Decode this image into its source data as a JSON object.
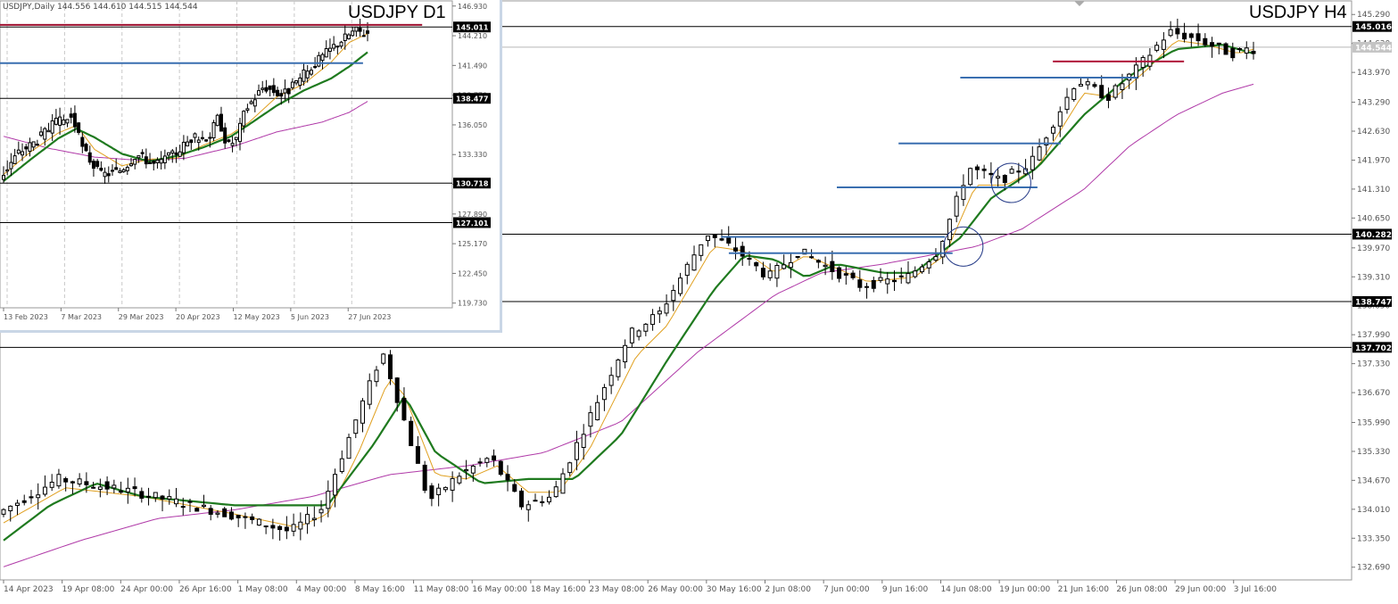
{
  "main": {
    "title": "USDJPY H4",
    "y_ticks": [
      "145.290",
      "144.630",
      "143.970",
      "143.290",
      "142.630",
      "141.970",
      "141.310",
      "140.650",
      "139.970",
      "139.310",
      "138.650",
      "137.990",
      "137.330",
      "136.670",
      "135.990",
      "135.330",
      "134.670",
      "134.010",
      "133.350",
      "132.690"
    ],
    "x_ticks": [
      "14 Apr 2023",
      "19 Apr 08:00",
      "24 Apr 00:00",
      "26 Apr 16:00",
      "1 May 08:00",
      "4 May 00:00",
      "8 May 16:00",
      "11 May 08:00",
      "16 May 00:00",
      "18 May 16:00",
      "23 May 08:00",
      "26 May 00:00",
      "30 May 16:00",
      "2 Jun 08:00",
      "7 Jun 00:00",
      "9 Jun 16:00",
      "14 Jun 08:00",
      "19 Jun 00:00",
      "21 Jun 16:00",
      "26 Jun 08:00",
      "29 Jun 00:00",
      "3 Jul 16:00"
    ],
    "price_labels": [
      "145.016",
      "144.544",
      "140.282",
      "138.747",
      "137.702"
    ]
  },
  "inset": {
    "title": "USDJPY D1",
    "info": "USDJPY,Daily  144.556 144.610 144.515 144.544",
    "y_ticks": [
      "146.930",
      "144.210",
      "141.490",
      "138.770",
      "136.050",
      "133.330",
      "130.610",
      "127.890",
      "125.170",
      "122.450",
      "119.730"
    ],
    "x_ticks": [
      "13 Feb 2023",
      "7 Mar 2023",
      "29 Mar 2023",
      "20 Apr 2023",
      "12 May 2023",
      "5 Jun 2023",
      "27 Jun 2023"
    ],
    "price_labels": [
      "145.011",
      "138.477",
      "130.718",
      "127.101"
    ]
  },
  "chart_data": [
    {
      "type": "candlestick",
      "title": "USDJPY H4",
      "ylim": [
        132.4,
        145.6
      ],
      "y_ticks": [
        145.29,
        144.63,
        143.97,
        143.29,
        142.63,
        141.97,
        141.31,
        140.65,
        139.97,
        139.31,
        138.65,
        137.99,
        137.33,
        136.67,
        135.99,
        135.33,
        134.67,
        134.01,
        133.35,
        132.69
      ],
      "x_categories": [
        "14 Apr 2023",
        "19 Apr 08:00",
        "24 Apr 00:00",
        "26 Apr 16:00",
        "1 May 08:00",
        "4 May 00:00",
        "8 May 16:00",
        "11 May 08:00",
        "16 May 00:00",
        "18 May 16:00",
        "23 May 08:00",
        "26 May 00:00",
        "30 May 16:00",
        "2 Jun 08:00",
        "7 Jun 00:00",
        "9 Jun 16:00",
        "14 Jun 08:00",
        "19 Jun 00:00",
        "21 Jun 16:00",
        "26 Jun 08:00",
        "29 Jun 00:00",
        "3 Jul 16:00"
      ],
      "price_path": [
        [
          0,
          133.9
        ],
        [
          4,
          134.7
        ],
        [
          9,
          134.4
        ],
        [
          15,
          133.9
        ],
        [
          19,
          133.5
        ],
        [
          21,
          134.0
        ],
        [
          23,
          135.8
        ],
        [
          25,
          137.6
        ],
        [
          26,
          136.5
        ],
        [
          28,
          134.2
        ],
        [
          30,
          134.8
        ],
        [
          32,
          135.2
        ],
        [
          34,
          134.1
        ],
        [
          36,
          134.3
        ],
        [
          38,
          135.8
        ],
        [
          41,
          138.0
        ],
        [
          43,
          138.5
        ],
        [
          46,
          140.3
        ],
        [
          48,
          139.9
        ],
        [
          50,
          139.3
        ],
        [
          52,
          139.9
        ],
        [
          54,
          139.5
        ],
        [
          56,
          139.1
        ],
        [
          59,
          139.3
        ],
        [
          61,
          139.9
        ],
        [
          63,
          141.8
        ],
        [
          65,
          141.5
        ],
        [
          67,
          141.9
        ],
        [
          70,
          143.8
        ],
        [
          72,
          143.4
        ],
        [
          74,
          144.1
        ],
        [
          76,
          144.9
        ],
        [
          78,
          144.7
        ],
        [
          80,
          144.4
        ],
        [
          81,
          144.5
        ]
      ],
      "moving_averages": {
        "fast": [
          [
            0,
            133.7
          ],
          [
            4,
            134.5
          ],
          [
            9,
            134.3
          ],
          [
            15,
            133.9
          ],
          [
            19,
            133.6
          ],
          [
            21,
            133.9
          ],
          [
            23,
            135.3
          ],
          [
            25,
            137.0
          ],
          [
            26,
            136.6
          ],
          [
            28,
            134.8
          ],
          [
            30,
            134.7
          ],
          [
            32,
            135.0
          ],
          [
            34,
            134.4
          ],
          [
            36,
            134.4
          ],
          [
            38,
            135.4
          ],
          [
            41,
            137.5
          ],
          [
            43,
            138.2
          ],
          [
            46,
            140.0
          ],
          [
            48,
            139.9
          ],
          [
            50,
            139.4
          ],
          [
            52,
            139.8
          ],
          [
            54,
            139.5
          ],
          [
            56,
            139.2
          ],
          [
            59,
            139.3
          ],
          [
            61,
            139.8
          ],
          [
            63,
            141.4
          ],
          [
            65,
            141.4
          ],
          [
            67,
            141.8
          ],
          [
            70,
            143.5
          ],
          [
            72,
            143.4
          ],
          [
            74,
            144.0
          ],
          [
            76,
            144.7
          ],
          [
            78,
            144.6
          ],
          [
            80,
            144.4
          ],
          [
            81,
            144.5
          ]
        ],
        "medium": [
          [
            0,
            133.3
          ],
          [
            3,
            134.1
          ],
          [
            6,
            134.6
          ],
          [
            9,
            134.3
          ],
          [
            15,
            134.1
          ],
          [
            21,
            134.1
          ],
          [
            24,
            135.5
          ],
          [
            26,
            136.6
          ],
          [
            28,
            135.3
          ],
          [
            31,
            134.6
          ],
          [
            34,
            134.7
          ],
          [
            37,
            134.7
          ],
          [
            40,
            135.7
          ],
          [
            43,
            137.4
          ],
          [
            46,
            139.0
          ],
          [
            48,
            139.8
          ],
          [
            50,
            139.7
          ],
          [
            52,
            139.3
          ],
          [
            54,
            139.6
          ],
          [
            57,
            139.4
          ],
          [
            59,
            139.4
          ],
          [
            62,
            140.2
          ],
          [
            64,
            141.1
          ],
          [
            67,
            141.8
          ],
          [
            70,
            143.0
          ],
          [
            73,
            143.9
          ],
          [
            76,
            144.5
          ],
          [
            79,
            144.6
          ],
          [
            81,
            144.4
          ]
        ],
        "slow": [
          [
            0,
            132.7
          ],
          [
            5,
            133.3
          ],
          [
            10,
            133.8
          ],
          [
            15,
            134.0
          ],
          [
            20,
            134.3
          ],
          [
            25,
            134.8
          ],
          [
            30,
            135.0
          ],
          [
            35,
            135.3
          ],
          [
            40,
            136.0
          ],
          [
            45,
            137.6
          ],
          [
            50,
            138.9
          ],
          [
            53,
            139.4
          ],
          [
            57,
            139.6
          ],
          [
            60,
            139.8
          ],
          [
            63,
            140.0
          ],
          [
            66,
            140.4
          ],
          [
            70,
            141.3
          ],
          [
            73,
            142.3
          ],
          [
            76,
            143.0
          ],
          [
            79,
            143.5
          ],
          [
            81,
            143.7
          ]
        ]
      },
      "horizontal_levels": [
        145.016,
        144.544,
        140.282,
        138.747,
        137.702
      ],
      "support_resistance": [
        {
          "from": 68,
          "to": 76.5,
          "price": 144.22,
          "color": "#b0103a"
        },
        {
          "from": 62,
          "to": 73.5,
          "price": 143.85,
          "color": "#3a6fb0"
        },
        {
          "from": 58,
          "to": 68.5,
          "price": 142.35,
          "color": "#3a6fb0"
        },
        {
          "from": 54,
          "to": 67,
          "price": 141.35,
          "color": "#3a6fb0"
        },
        {
          "from": 46.5,
          "to": 61,
          "price": 140.22,
          "color": "#3a6fb0"
        },
        {
          "from": 47,
          "to": 61.5,
          "price": 139.85,
          "color": "#3a6fb0"
        }
      ],
      "circled": [
        {
          "x": 62.2,
          "y": 140.0
        },
        {
          "x": 65.3,
          "y": 141.45
        }
      ]
    },
    {
      "type": "candlestick",
      "title": "USDJPY D1",
      "ylim": [
        119.3,
        147.4
      ],
      "y_ticks": [
        146.93,
        144.21,
        141.49,
        138.77,
        136.05,
        133.33,
        130.61,
        127.89,
        125.17,
        122.45,
        119.73
      ],
      "x_categories": [
        "13 Feb 2023",
        "7 Mar 2023",
        "29 Mar 2023",
        "20 Apr 2023",
        "12 May 2023",
        "5 Jun 2023",
        "27 Jun 2023"
      ],
      "price_path": [
        [
          0,
          131.2
        ],
        [
          2,
          133.5
        ],
        [
          4,
          134.6
        ],
        [
          6,
          136.2
        ],
        [
          8,
          136.8
        ],
        [
          9,
          134.0
        ],
        [
          11,
          131.5
        ],
        [
          13,
          131.8
        ],
        [
          14,
          132.5
        ],
        [
          15,
          133.4
        ],
        [
          17,
          132.4
        ],
        [
          19,
          133.3
        ],
        [
          21,
          134.8
        ],
        [
          23,
          135.0
        ],
        [
          24,
          136.8
        ],
        [
          25,
          134.1
        ],
        [
          26,
          134.8
        ],
        [
          27,
          137.5
        ],
        [
          29,
          139.6
        ],
        [
          31,
          138.8
        ],
        [
          32,
          139.4
        ],
        [
          33,
          140.3
        ],
        [
          35,
          142.0
        ],
        [
          37,
          143.5
        ],
        [
          39,
          144.7
        ],
        [
          40,
          144.5
        ]
      ],
      "moving_averages": {
        "fast": [
          [
            0,
            131.5
          ],
          [
            3,
            133.6
          ],
          [
            6,
            135.3
          ],
          [
            8,
            136.0
          ],
          [
            10,
            133.8
          ],
          [
            13,
            132.3
          ],
          [
            16,
            132.9
          ],
          [
            19,
            133.0
          ],
          [
            22,
            134.2
          ],
          [
            25,
            135.2
          ],
          [
            27,
            136.3
          ],
          [
            30,
            138.6
          ],
          [
            33,
            139.8
          ],
          [
            36,
            141.8
          ],
          [
            38,
            143.6
          ],
          [
            40,
            144.4
          ]
        ],
        "medium": [
          [
            0,
            130.9
          ],
          [
            3,
            132.9
          ],
          [
            6,
            134.8
          ],
          [
            8,
            135.7
          ],
          [
            10,
            134.9
          ],
          [
            13,
            133.4
          ],
          [
            16,
            132.7
          ],
          [
            19,
            133.2
          ],
          [
            22,
            134.0
          ],
          [
            25,
            135.0
          ],
          [
            27,
            136.1
          ],
          [
            30,
            137.8
          ],
          [
            33,
            139.2
          ],
          [
            36,
            140.3
          ],
          [
            38,
            141.4
          ],
          [
            40,
            142.7
          ]
        ],
        "slow": [
          [
            0,
            135.0
          ],
          [
            5,
            133.9
          ],
          [
            10,
            133.1
          ],
          [
            15,
            132.8
          ],
          [
            20,
            133.0
          ],
          [
            25,
            134.0
          ],
          [
            30,
            135.4
          ],
          [
            35,
            136.3
          ],
          [
            38,
            137.2
          ],
          [
            40,
            138.2
          ]
        ]
      },
      "horizontal_levels": [
        145.011,
        138.477,
        130.718,
        127.101
      ],
      "support_resistance": [
        {
          "from": 0,
          "to": 46,
          "price": 145.2,
          "color": "#a01030"
        },
        {
          "from": 0,
          "to": 39.5,
          "price": 141.7,
          "color": "#3a6fb0"
        }
      ]
    }
  ]
}
